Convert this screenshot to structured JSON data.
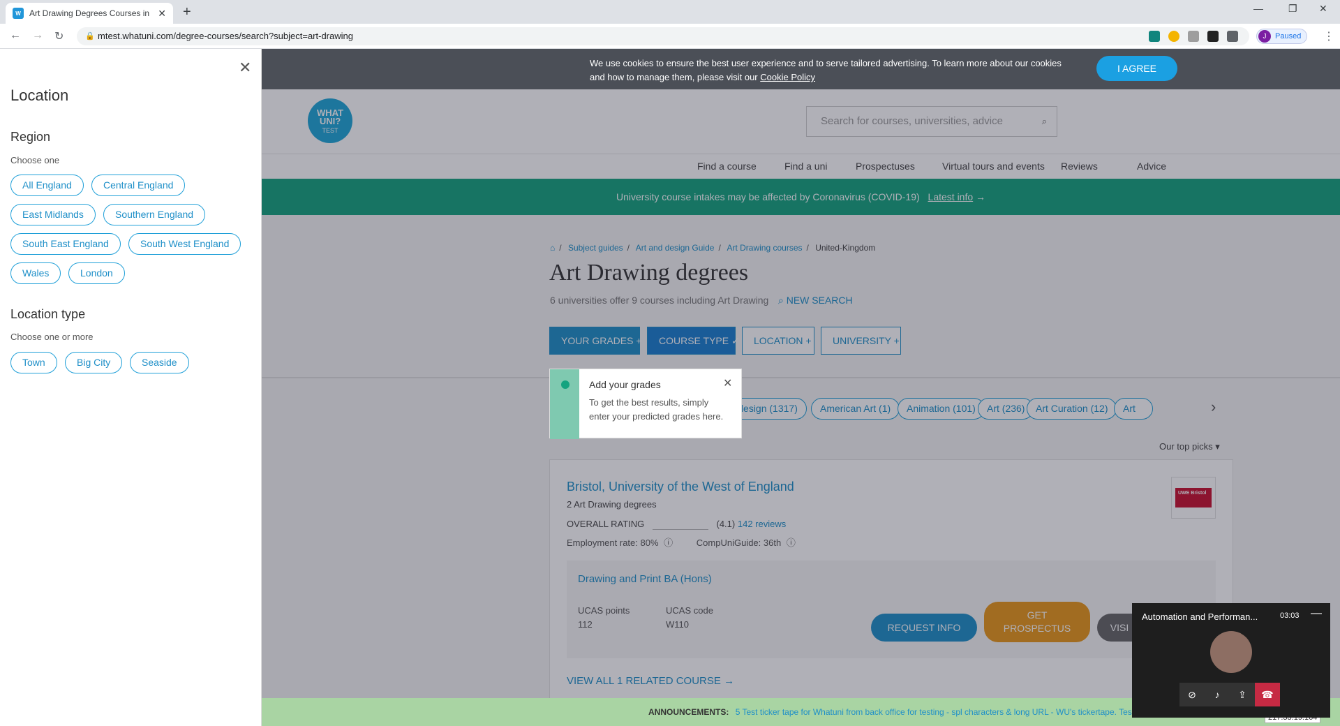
{
  "browser": {
    "tab_title": "Art Drawing Degrees Courses in",
    "url": "mtest.whatuni.com/degree-courses/search?subject=art-drawing",
    "profile_initial": "J",
    "profile_status": "Paused"
  },
  "left_panel": {
    "title": "Location",
    "region_heading": "Region",
    "region_hint": "Choose one",
    "regions": [
      "All England",
      "Central England",
      "East Midlands",
      "Southern England",
      "South East England",
      "South West England",
      "Wales",
      "London"
    ],
    "location_type_heading": "Location type",
    "location_type_hint": "Choose one or more",
    "location_types": [
      "Town",
      "Big City",
      "Seaside"
    ]
  },
  "cookie": {
    "text": "We use cookies to ensure the best user experience and to serve tailored advertising. To learn more about our cookies and how to manage them, please visit our",
    "link": "Cookie Policy",
    "button": "I AGREE"
  },
  "header": {
    "logo_text": [
      "WHAT",
      "UNI?",
      "TEST"
    ],
    "search_placeholder": "Search for courses, universities, advice"
  },
  "nav": [
    "Find a course",
    "Find a uni",
    "Prospectuses",
    "Virtual tours and events",
    "Reviews",
    "Advice"
  ],
  "covid": {
    "text": "University course intakes may be affected by Coronavirus (COVID-19)",
    "link": "Latest info"
  },
  "breadcrumb": [
    "Subject guides",
    "Art and design Guide",
    "Art Drawing courses",
    "United-Kingdom"
  ],
  "page_title": "Art Drawing degrees",
  "subline": "6 universities offer 9 courses including Art Drawing",
  "new_search": "NEW SEARCH",
  "filters": {
    "grades": "YOUR GRADES",
    "course_type": "COURSE TYPE",
    "location": "LOCATION",
    "university": "UNIVERSITY"
  },
  "tooltip": {
    "title": "Add your grades",
    "text": "To get the best results, simply enter your predicted grades here."
  },
  "chips": [
    "and design (1317)",
    "American Art (1)",
    "Animation (101)",
    "Art (236)",
    "Art Curation (12)",
    "Art"
  ],
  "sort_label": "Our top picks",
  "result": {
    "uni_name": "Bristol, University of the West of England",
    "degrees": "2 Art Drawing degrees",
    "rating_label": "OVERALL RATING",
    "rating_value": "(4.1)",
    "reviews": "142 reviews",
    "employment": "Employment rate: 80%",
    "compuni": "CompUniGuide: 36th",
    "logo_text": "UWE Bristol",
    "course_title": "Drawing and Print BA (Hons)",
    "ucas_points_label": "UCAS points",
    "ucas_points": "112",
    "ucas_code_label": "UCAS code",
    "ucas_code": "W110",
    "btn_request": "REQUEST INFO",
    "btn_prospectus": "GET PROSPECTUS",
    "btn_visit": "VISI",
    "view_all": "VIEW ALL 1 RELATED COURSE"
  },
  "ticker": {
    "label": "ANNOUNCEMENTS:",
    "text": "5 Test ticker tape for Whatuni from back office for testing - spl characters & long URL - WU's tickertape. Test long url..!"
  },
  "ip": "217.33.19.164",
  "video_call": {
    "title": "Automation and Performan...",
    "time": "03:03"
  }
}
